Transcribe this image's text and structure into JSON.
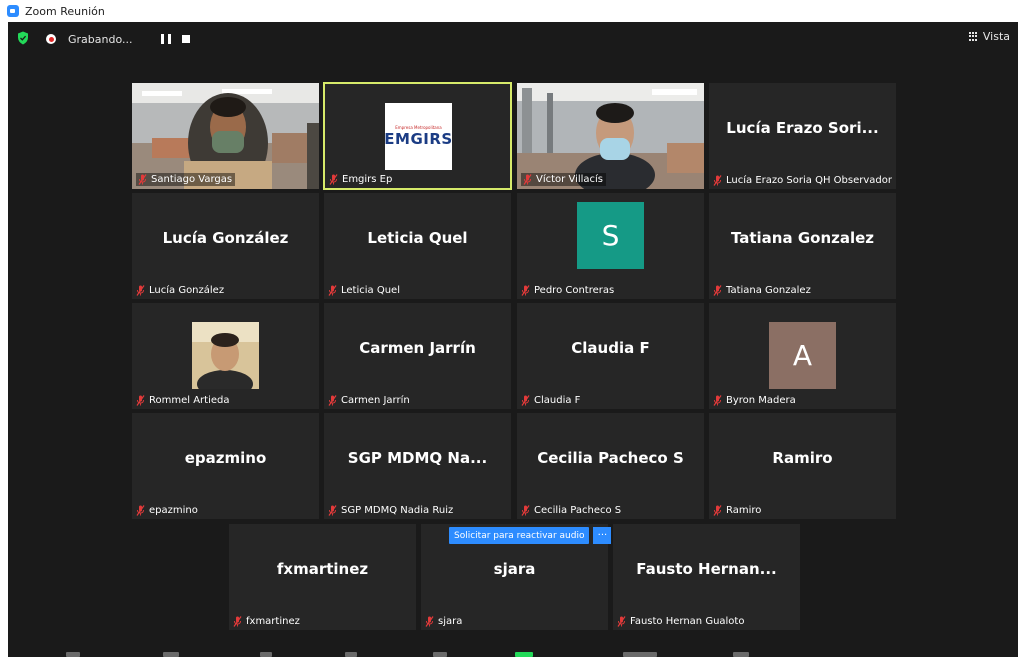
{
  "window": {
    "title": "Zoom Reunión"
  },
  "recording": {
    "status": "Grabando..."
  },
  "view": {
    "label": "Vista"
  },
  "unmute": {
    "label": "Solicitar para reactivar audio",
    "more": "···"
  },
  "emgirs_logo": {
    "small": "Empresa Metropolitana",
    "big": "EMGIRS"
  },
  "participants": {
    "p0": {
      "label": "Santiago Vargas"
    },
    "p1": {
      "label": "Emgirs Ep"
    },
    "p2": {
      "label": "Víctor Villacís"
    },
    "p3": {
      "name": "Lucía Erazo Sori...",
      "label": "Lucía Erazo Soria QH Observador"
    },
    "p4": {
      "name": "Lucía González",
      "label": "Lucía González"
    },
    "p5": {
      "name": "Leticia Quel",
      "label": "Leticia Quel"
    },
    "p6": {
      "avatar": "S",
      "label": "Pedro Contreras"
    },
    "p7": {
      "name": "Tatiana Gonzalez",
      "label": "Tatiana Gonzalez"
    },
    "p8": {
      "label": "Rommel Artieda"
    },
    "p9": {
      "name": "Carmen Jarrín",
      "label": "Carmen Jarrín"
    },
    "p10": {
      "name": "Claudia F",
      "label": "Claudia F"
    },
    "p11": {
      "avatar": "A",
      "label": "Byron Madera"
    },
    "p12": {
      "name": "epazmino",
      "label": "epazmino"
    },
    "p13": {
      "name": "SGP MDMQ Na...",
      "label": "SGP MDMQ Nadia Ruiz"
    },
    "p14": {
      "name": "Cecilia Pacheco S",
      "label": "Cecilia Pacheco S"
    },
    "p15": {
      "name": "Ramiro",
      "label": "Ramiro"
    },
    "p16": {
      "name": "fxmartinez",
      "label": "fxmartinez"
    },
    "p17": {
      "name": "sjara",
      "label": "sjara"
    },
    "p18": {
      "name": "Fausto Hernan...",
      "label": "Fausto Hernan Gualoto"
    }
  },
  "colors": {
    "background": "#1a1a1a",
    "tile": "#262626",
    "active_speaker": "#d6ea6a",
    "accent": "#2d8cff",
    "muted": "#e02828"
  }
}
